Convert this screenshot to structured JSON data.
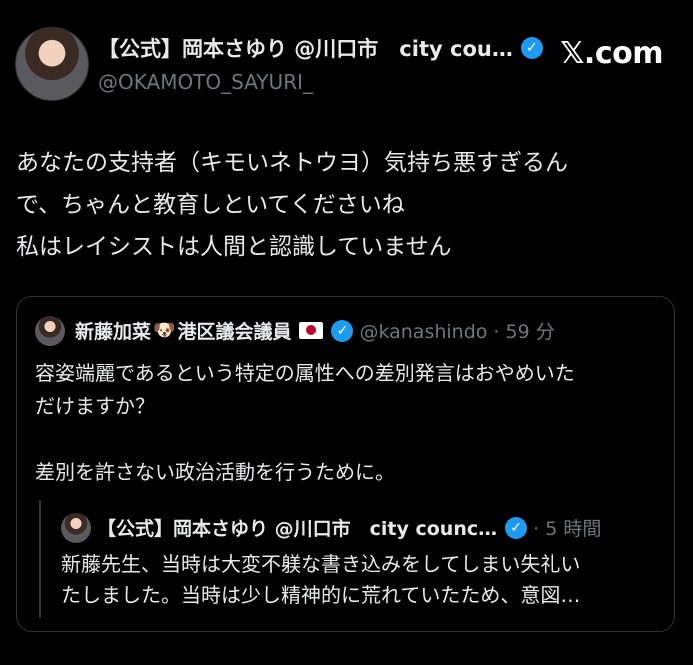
{
  "author": {
    "name": "【公式】岡本さゆり @川口市　city cou…",
    "handle": "@OKAMOTO_SAYURI_",
    "verified_icon": "check"
  },
  "brand": "𝕏.com",
  "tweet": {
    "lines": [
      "あなたの支持者（キモいネトウヨ）気持ち悪すぎるん",
      "で、ちゃんと教育しといてくださいね",
      "私はレイシストは人間と認識していません"
    ]
  },
  "quote": {
    "name_part1": "新藤加菜",
    "dog_emoji": "🐶",
    "name_part2": "港区議会議員",
    "verified_icon": "check",
    "handle_time": "@kanashindo · 59 分",
    "lines": [
      "容姿端麗であるという特定の属性への差別発言はおやめいた",
      "だけますか？",
      "",
      "差別を許さない政治活動を行うために。"
    ],
    "nested": {
      "name": "【公式】岡本さゆり @川口市　city counc…",
      "verified_icon": "check",
      "time": "· 5 時間",
      "lines": [
        "新藤先生、当時は大変不躾な書き込みをしてしまい失礼い",
        "たしました。当時は少し精神的に荒れていたため、意図…"
      ]
    }
  }
}
